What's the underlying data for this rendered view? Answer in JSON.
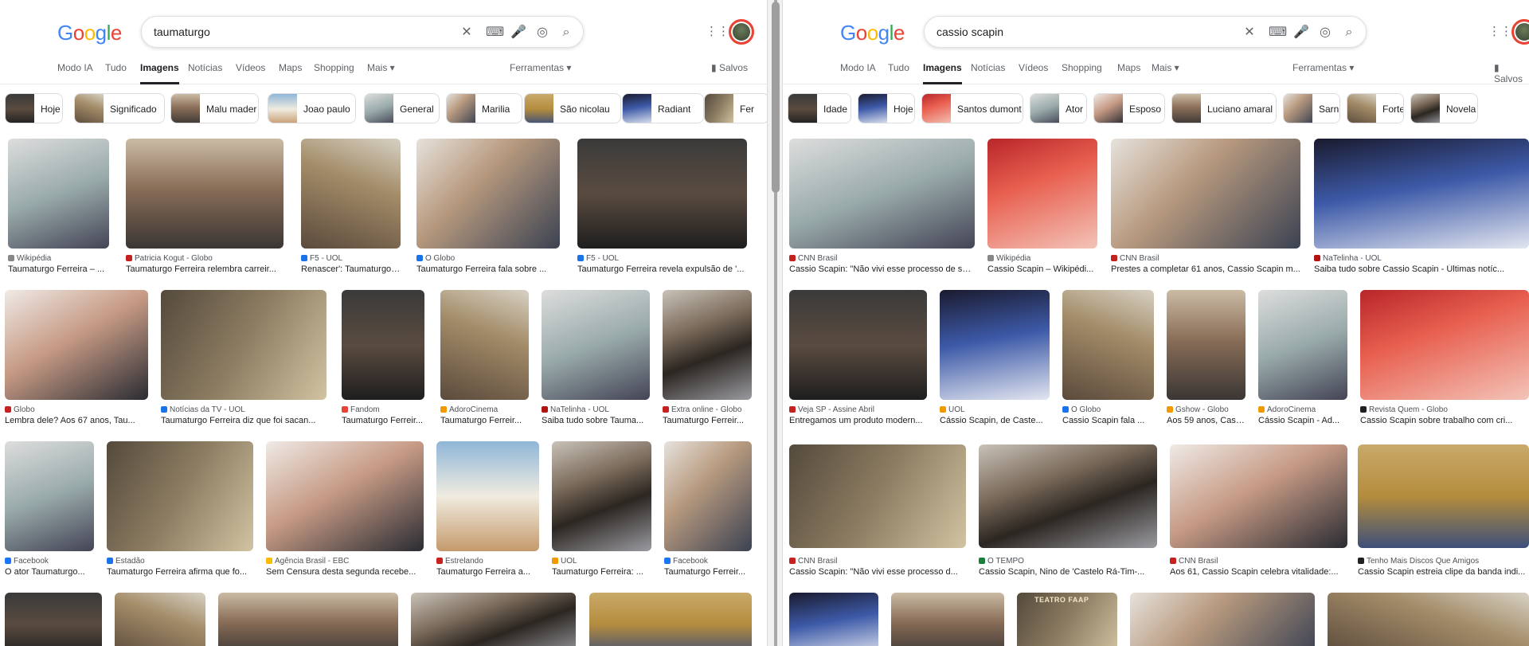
{
  "left": {
    "query": "taumaturgo",
    "tabs": [
      "Modo IA",
      "Tudo",
      "Imagens",
      "Notícias",
      "Vídeos",
      "Maps",
      "Shopping",
      "Mais"
    ],
    "active_tab": "Imagens",
    "tools": "Ferramentas",
    "saved": "Salvos",
    "chips": [
      "Hoje",
      "Significado",
      "Malu mader",
      "Joao paulo",
      "General",
      "Marilia",
      "São nicolau",
      "Radiant",
      "Fer"
    ],
    "row1": [
      {
        "src": "Wikipédia",
        "cap": "Taumaturgo Ferreira – ..."
      },
      {
        "src": "Patricia Kogut - Globo",
        "cap": "Taumaturgo Ferreira relembra carreir..."
      },
      {
        "src": "F5 - UOL",
        "cap": "Renascer': Taumaturgo ..."
      },
      {
        "src": "O Globo",
        "cap": "Taumaturgo Ferreira fala sobre ..."
      },
      {
        "src": "F5 - UOL",
        "cap": "Taumaturgo Ferreira revela expulsão de '..."
      }
    ],
    "row2": [
      {
        "src": "Globo",
        "cap": "Lembra dele? Aos 67 anos, Tau..."
      },
      {
        "src": "Notícias da TV - UOL",
        "cap": "Taumaturgo Ferreira diz que foi sacan..."
      },
      {
        "src": "Fandom",
        "cap": "Taumaturgo Ferreir..."
      },
      {
        "src": "AdoroCinema",
        "cap": "Taumaturgo Ferreir..."
      },
      {
        "src": "NaTelinha - UOL",
        "cap": "Saiba tudo sobre Tauma..."
      },
      {
        "src": "Extra online - Globo",
        "cap": "Taumaturgo Ferreir..."
      }
    ],
    "row3": [
      {
        "src": "Facebook",
        "cap": "O ator Taumaturgo..."
      },
      {
        "src": "Estadão",
        "cap": "Taumaturgo Ferreira afirma que fo..."
      },
      {
        "src": "Agência Brasil - EBC",
        "cap": "Sem Censura desta segunda recebe..."
      },
      {
        "src": "Estrelando",
        "cap": "Taumaturgo Ferreira a..."
      },
      {
        "src": "UOL",
        "cap": "Taumaturgo Ferreira: ..."
      },
      {
        "src": "Facebook",
        "cap": "Taumaturgo Ferreir..."
      }
    ]
  },
  "right": {
    "query": "cassio scapin",
    "tabs": [
      "Modo IA",
      "Tudo",
      "Imagens",
      "Notícias",
      "Vídeos",
      "Shopping",
      "Maps",
      "Mais"
    ],
    "active_tab": "Imagens",
    "tools": "Ferramentas",
    "saved": "Salvos",
    "chips": [
      "Idade",
      "Hoje",
      "Santos dumont",
      "Ator",
      "Esposo",
      "Luciano amaral",
      "Sarna",
      "Forte",
      "Novela"
    ],
    "row1": [
      {
        "src": "CNN Brasil",
        "cap": "Cassio Scapin: \"Não vivi esse processo de sair..."
      },
      {
        "src": "Wikipédia",
        "cap": "Cassio Scapin – Wikipédi..."
      },
      {
        "src": "CNN Brasil",
        "cap": "Prestes a completar 61 anos, Cassio Scapin m..."
      },
      {
        "src": "NaTelinha - UOL",
        "cap": "Saiba tudo sobre Cassio Scapin - Últimas notíc..."
      }
    ],
    "row2": [
      {
        "src": "Veja SP - Assine Abril",
        "cap": "Entregamos um produto modern..."
      },
      {
        "src": "UOL",
        "cap": "Cássio Scapin, de Caste..."
      },
      {
        "src": "O Globo",
        "cap": "Cassio Scapin fala ..."
      },
      {
        "src": "Gshow - Globo",
        "cap": "Aos 59 anos, Cass..."
      },
      {
        "src": "AdoroCinema",
        "cap": "Cássio Scapin - Ad..."
      },
      {
        "src": "Revista Quem - Globo",
        "cap": "Cassio Scapin sobre trabalho com cri..."
      }
    ],
    "row3": [
      {
        "src": "CNN Brasil",
        "cap": "Cassio Scapin: \"Não vivi esse processo d..."
      },
      {
        "src": "O TEMPO",
        "cap": "Cassio Scapin, Nino de 'Castelo Rá-Tim-..."
      },
      {
        "src": "CNN Brasil",
        "cap": "Aos 61, Cassio Scapin celebra vitalidade:..."
      },
      {
        "src": "Tenho Mais Discos Que Amigos",
        "cap": "Cassio Scapin estreia clipe da banda indi..."
      }
    ],
    "row4_sign": "TEATRO FAAP"
  }
}
